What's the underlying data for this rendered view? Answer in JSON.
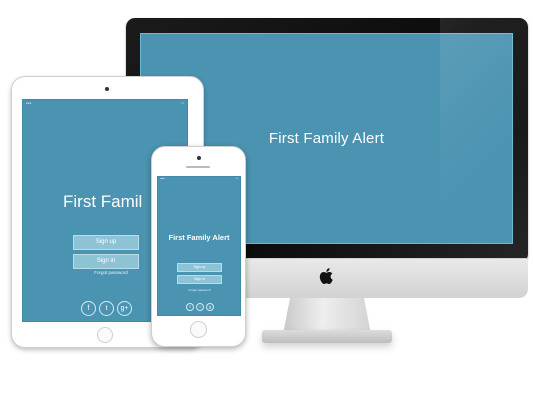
{
  "desktop": {
    "title": "First Family Alert"
  },
  "tablet": {
    "title": "First Famil",
    "signup_label": "Sign up",
    "signin_label": "Sign in",
    "forgot_label": "Forgot password",
    "social": [
      "f",
      "t",
      "g+"
    ]
  },
  "phone": {
    "title": "First Family Alert",
    "signup_label": "Sign up",
    "signin_label": "Sign in",
    "forgot_label": "Forgot password",
    "social": [
      "f",
      "t",
      "g"
    ]
  },
  "colors": {
    "screen": "#4a93b1",
    "button": "#8ec3d6",
    "bezel": "#111111"
  },
  "icons": [
    "apple-logo-icon",
    "facebook-icon",
    "twitter-icon",
    "google-plus-icon"
  ]
}
